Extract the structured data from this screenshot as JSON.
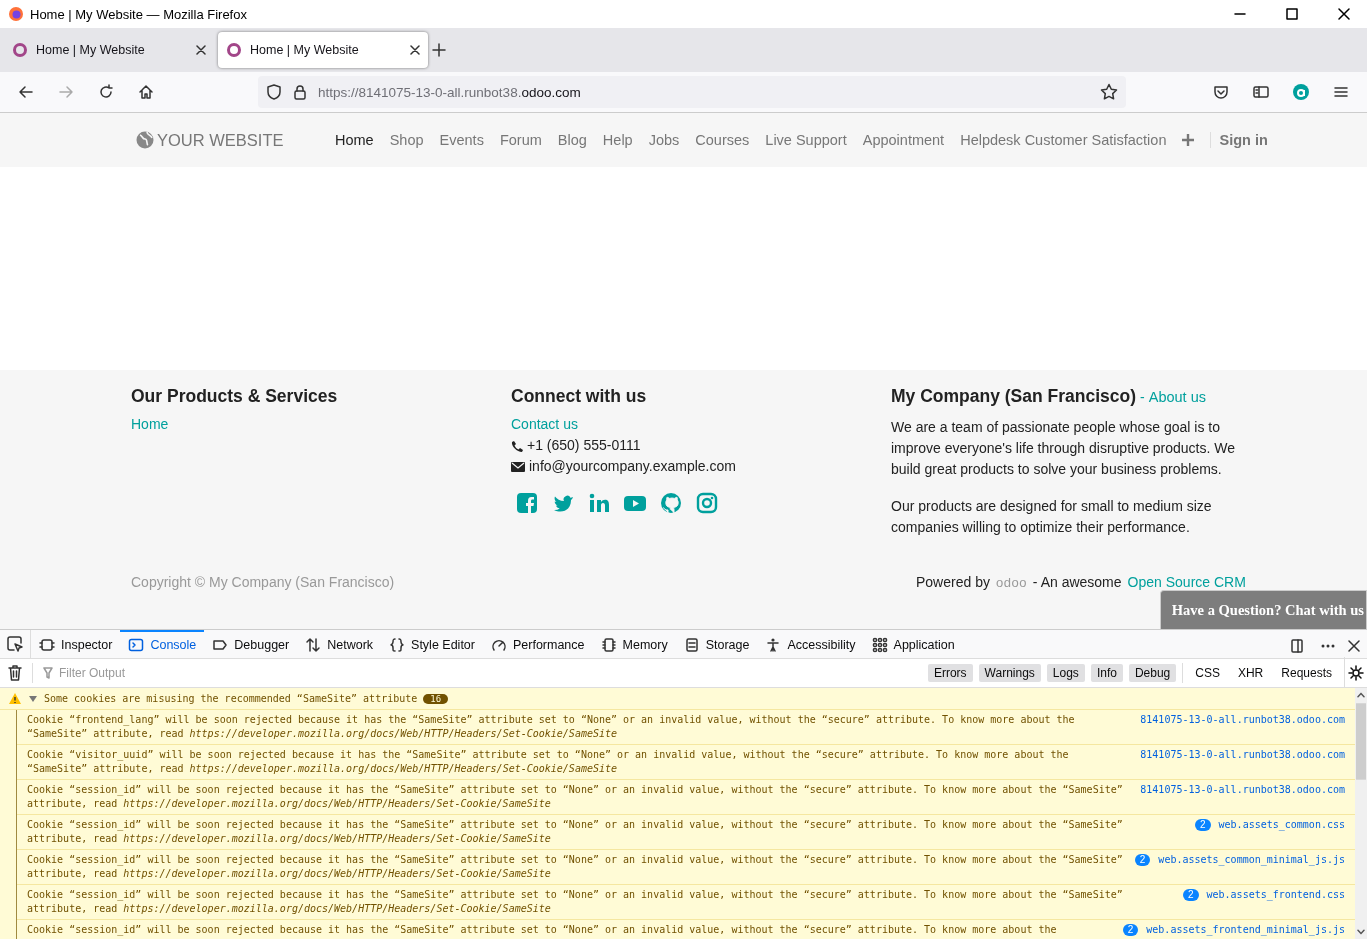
{
  "window": {
    "title": "Home | My Website — Mozilla Firefox"
  },
  "browser_tabs": [
    {
      "label": "Home | My Website",
      "selected": false
    },
    {
      "label": "Home | My Website",
      "selected": true
    }
  ],
  "address_bar": {
    "url_prefix": "https://8141075-13-0-all.runbot38.",
    "url_domain": "odoo.com"
  },
  "site": {
    "logo": "YOUR WEBSITE",
    "nav": [
      {
        "label": "Home",
        "selected": true
      },
      {
        "label": "Shop",
        "selected": false
      },
      {
        "label": "Events",
        "selected": false
      },
      {
        "label": "Forum",
        "selected": false
      },
      {
        "label": "Blog",
        "selected": false
      },
      {
        "label": "Help",
        "selected": false
      },
      {
        "label": "Jobs",
        "selected": false
      },
      {
        "label": "Courses",
        "selected": false
      },
      {
        "label": "Live Support",
        "selected": false
      },
      {
        "label": "Appointment",
        "selected": false
      },
      {
        "label": "Helpdesk Customer Satisfaction",
        "selected": false
      }
    ],
    "sign_in": "Sign in"
  },
  "footer": {
    "products": {
      "title": "Our Products & Services",
      "links": [
        "Home"
      ]
    },
    "connect": {
      "title": "Connect with us",
      "contact_link": "Contact us",
      "phone": "+1 (650) 555-0111",
      "email": "info@yourcompany.example.com"
    },
    "company": {
      "title": "My Company (San Francisco)",
      "separator": "-",
      "about_link": "About us",
      "paragraphs": [
        "We are a team of passionate people whose goal is to improve everyone's life through disruptive products. We build great products to solve your business problems.",
        "Our products are designed for small to medium size companies willing to optimize their performance."
      ]
    },
    "copyright": "Copyright © My Company (San Francisco)",
    "powered_by": "Powered by",
    "powered_logo": "odoo",
    "awesome": "- An awesome",
    "crm_link": "Open Source CRM"
  },
  "chat_button": "Have a Question? Chat with us",
  "devtools": {
    "tabs": [
      {
        "label": "Inspector",
        "selected": false
      },
      {
        "label": "Console",
        "selected": true
      },
      {
        "label": "Debugger",
        "selected": false
      },
      {
        "label": "Network",
        "selected": false
      },
      {
        "label": "Style Editor",
        "selected": false
      },
      {
        "label": "Performance",
        "selected": false
      },
      {
        "label": "Memory",
        "selected": false
      },
      {
        "label": "Storage",
        "selected": false
      },
      {
        "label": "Accessibility",
        "selected": false
      },
      {
        "label": "Application",
        "selected": false
      }
    ],
    "filter_placeholder": "Filter Output",
    "filters": [
      {
        "label": "Errors",
        "on": true
      },
      {
        "label": "Warnings",
        "on": true
      },
      {
        "label": "Logs",
        "on": true
      },
      {
        "label": "Info",
        "on": true
      },
      {
        "label": "Debug",
        "on": true
      },
      {
        "label": "CSS",
        "on": false
      },
      {
        "label": "XHR",
        "on": false
      },
      {
        "label": "Requests",
        "on": false
      }
    ],
    "group": {
      "message": "Some cookies are misusing the recommended “SameSite” attribute",
      "count": "16",
      "expanded": true
    },
    "messages": [
      {
        "text": "Cookie “frontend_lang” will be soon rejected because it has the “SameSite” attribute set to “None” or an invalid value, without the “secure” attribute. To know more about the “SameSite” attribute, read *https://developer.mozilla.org/docs/Web/HTTP/Headers/Set-Cookie/SameSite*",
        "source": "8141075-13-0-all.runbot38.odoo.com"
      },
      {
        "text": "Cookie “visitor_uuid” will be soon rejected because it has the “SameSite” attribute set to “None” or an invalid value, without the “secure” attribute. To know more about the “SameSite” attribute, read *https://developer.mozilla.org/docs/Web/HTTP/Headers/Set-Cookie/SameSite*",
        "source": "8141075-13-0-all.runbot38.odoo.com"
      },
      {
        "text": "Cookie “session_id” will be soon rejected because it has the “SameSite” attribute set to “None” or an invalid value, without the “secure” attribute. To know more about the “SameSite” attribute, read *https://developer.mozilla.org/docs/Web/HTTP/Headers/Set-Cookie/SameSite*",
        "source": "8141075-13-0-all.runbot38.odoo.com"
      },
      {
        "text": "Cookie “session_id” will be soon rejected because it has the “SameSite” attribute set to “None” or an invalid value, without the “secure” attribute. To know more about the “SameSite” attribute, read *https://developer.mozilla.org/docs/Web/HTTP/Headers/Set-Cookie/SameSite*",
        "source": "web.assets_common.css",
        "count": "2"
      },
      {
        "text": "Cookie “session_id” will be soon rejected because it has the “SameSite” attribute set to “None” or an invalid value, without the “secure” attribute. To know more about the “SameSite” attribute, read *https://developer.mozilla.org/docs/Web/HTTP/Headers/Set-Cookie/SameSite*",
        "source": "web.assets_common_minimal_js.js",
        "count": "2"
      },
      {
        "text": "Cookie “session_id” will be soon rejected because it has the “SameSite” attribute set to “None” or an invalid value, without the “secure” attribute. To know more about the “SameSite” attribute, read *https://developer.mozilla.org/docs/Web/HTTP/Headers/Set-Cookie/SameSite*",
        "source": "web.assets_frontend.css",
        "count": "2"
      },
      {
        "text": "Cookie “session_id” will be soon rejected because it has the “SameSite” attribute set to “None” or an invalid value, without the “secure” attribute. To know more about the",
        "source": "web.assets_frontend_minimal_js.js",
        "count": "2"
      }
    ]
  }
}
